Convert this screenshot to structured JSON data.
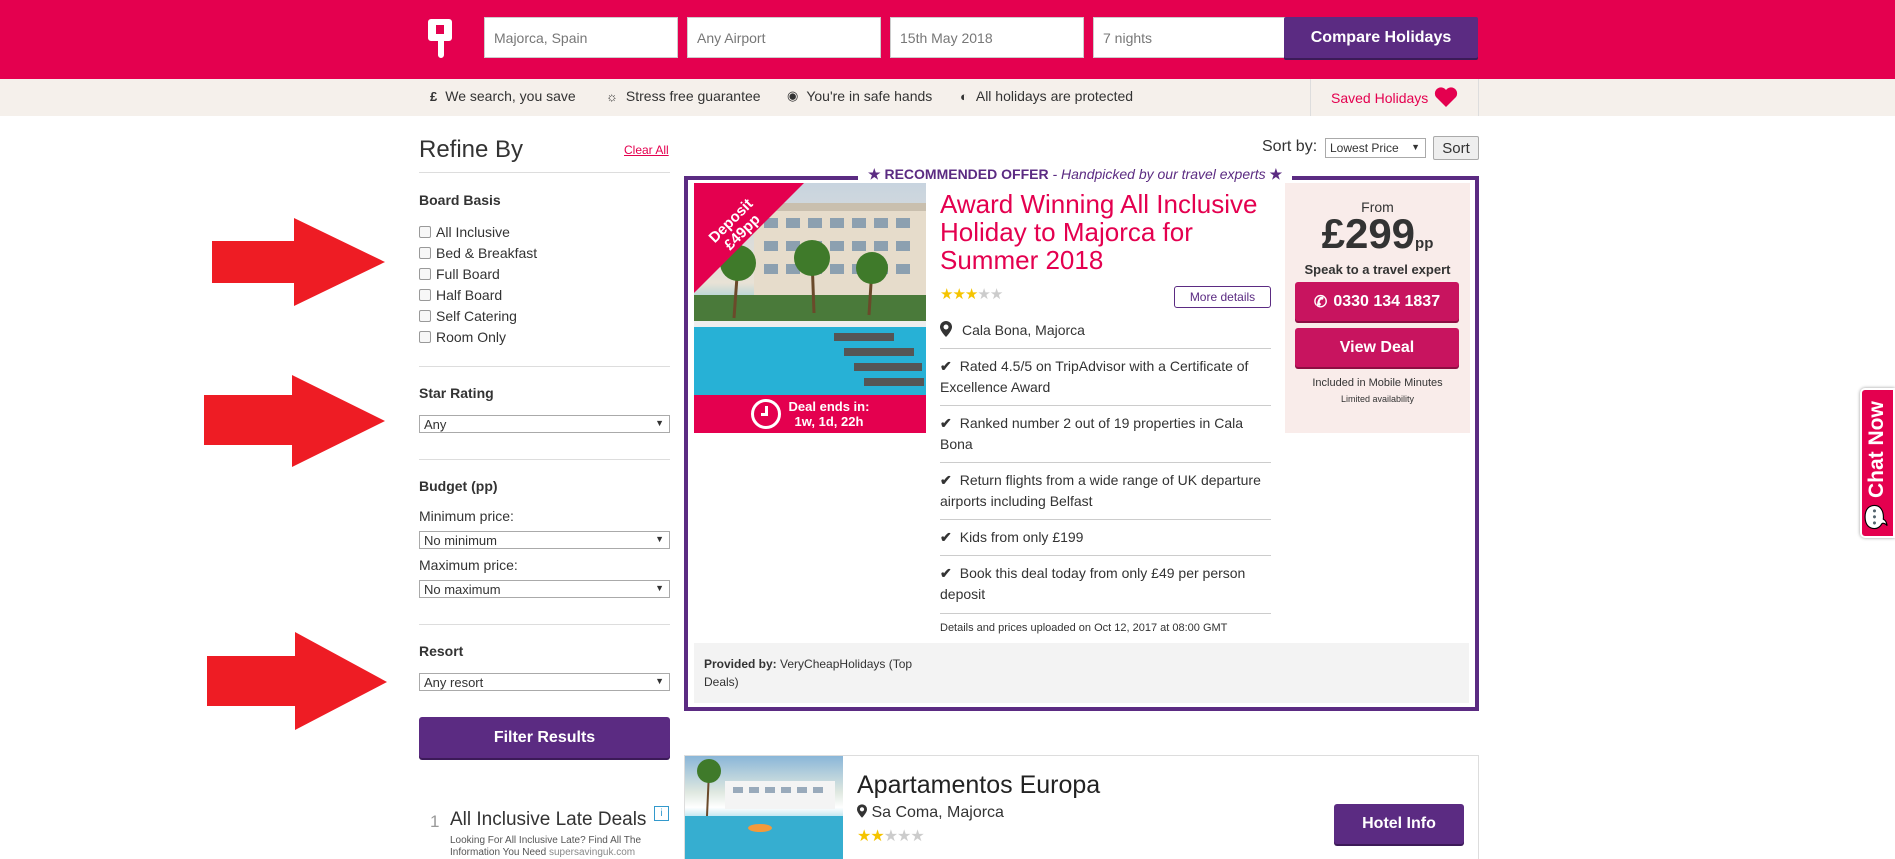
{
  "search": {
    "destination": "Majorca, Spain",
    "airport": "Any Airport",
    "date": "15th May 2018",
    "nights": "7 nights",
    "compare_label": "Compare Holidays"
  },
  "usps": [
    {
      "icon": "pound-icon",
      "label": "We search, you save"
    },
    {
      "icon": "sun-icon",
      "label": "Stress free guarantee"
    },
    {
      "icon": "eye-icon",
      "label": "You're in safe hands"
    },
    {
      "icon": "shield-icon",
      "label": "All holidays are protected"
    }
  ],
  "usp_glyphs": [
    "£",
    "☼",
    "◉",
    "◐"
  ],
  "saved_holidays": "Saved Holidays",
  "sidebar": {
    "title": "Refine By",
    "clear_all": "Clear All",
    "board_basis_title": "Board Basis",
    "board_options": [
      "All Inclusive",
      "Bed & Breakfast",
      "Full Board",
      "Half Board",
      "Self Catering",
      "Room Only"
    ],
    "star_rating_title": "Star Rating",
    "star_rating_value": "Any",
    "budget_title": "Budget (pp)",
    "min_label": "Minimum price:",
    "min_value": "No minimum",
    "max_label": "Maximum price:",
    "max_value": "No maximum",
    "resort_title": "Resort",
    "resort_value": "Any resort",
    "filter_label": "Filter Results"
  },
  "ad": {
    "number": "1",
    "title": "All Inclusive Late Deals",
    "desc": "Looking For All Inclusive Late? Find All The Information You Need",
    "domain": "supersavinguk.com",
    "badge": "i"
  },
  "sort": {
    "label": "Sort by:",
    "value": "Lowest Price",
    "button": "Sort"
  },
  "offer": {
    "recommended_label": "RECOMMENDED OFFER",
    "handpicked": "- Handpicked by our travel experts",
    "deposit_line1": "Deposit",
    "deposit_line2": "£49pp",
    "deal_ends_label": "Deal ends in:",
    "deal_ends_value": "1w, 1d, 22h",
    "title": "Award Winning All Inclusive Holiday to Majorca for Summer 2018",
    "stars": 3,
    "more_details": "More details",
    "location": "Cala Bona, Majorca",
    "features": [
      "Rated 4.5/5 on TripAdvisor with a Certificate of Excellence Award",
      "Ranked number 2 out of 19 properties in Cala Bona",
      "Return flights from a wide range of UK departure airports including Belfast",
      "Kids from only £199",
      "Book this deal today from only £49 per person deposit"
    ],
    "uploaded": "Details and prices uploaded on Oct 12, 2017 at 08:00 GMT",
    "from_label": "From",
    "price": "£299",
    "price_unit": "pp",
    "speak": "Speak to a travel expert",
    "phone": "0330 134 1837",
    "view_deal": "View Deal",
    "mobile_minutes": "Included in Mobile Minutes",
    "limited": "Limited availability",
    "provided_by_label": "Provided by:",
    "provided_by_value": "VeryCheapHolidays (Top Deals)"
  },
  "result2": {
    "title": "Apartamentos Europa",
    "location": "Sa Coma, Majorca",
    "stars": 2,
    "button": "Hotel Info"
  },
  "chat_now": "Chat Now",
  "colors": {
    "brand_pink": "#e4004f",
    "brand_purple": "#5b2b82",
    "arrow_red": "#ee1c24"
  }
}
